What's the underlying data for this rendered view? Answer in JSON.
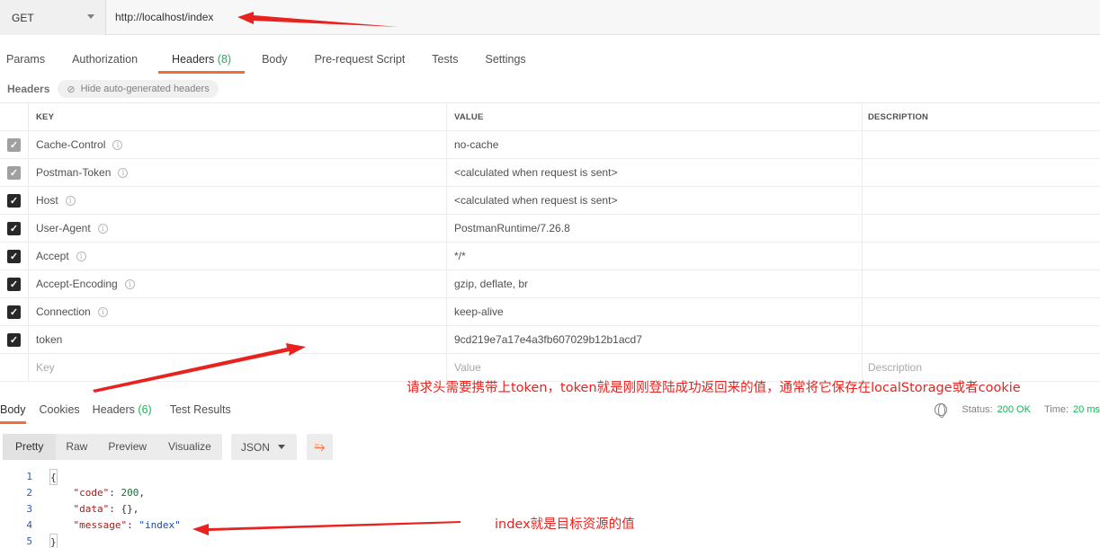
{
  "request": {
    "method": "GET",
    "url": "http://localhost/index"
  },
  "req_tabs": [
    {
      "label": "Params",
      "count": ""
    },
    {
      "label": "Authorization",
      "count": ""
    },
    {
      "label": "Headers",
      "count": "(8)"
    },
    {
      "label": "Body",
      "count": ""
    },
    {
      "label": "Pre-request Script",
      "count": ""
    },
    {
      "label": "Tests",
      "count": ""
    },
    {
      "label": "Settings",
      "count": ""
    }
  ],
  "headers_section": {
    "title": "Headers",
    "hide_label": "Hide auto-generated headers"
  },
  "table": {
    "columns": [
      "KEY",
      "VALUE",
      "DESCRIPTION"
    ],
    "rows": [
      {
        "key": "Cache-Control",
        "value": "no-cache",
        "checked": "grey",
        "info": "i"
      },
      {
        "key": "Postman-Token",
        "value": "<calculated when request is sent>",
        "checked": "grey",
        "info": "i"
      },
      {
        "key": "Host",
        "value": "<calculated when request is sent>",
        "checked": "dark",
        "info": "i"
      },
      {
        "key": "User-Agent",
        "value": "PostmanRuntime/7.26.8",
        "checked": "dark",
        "info": "i"
      },
      {
        "key": "Accept",
        "value": "*/*",
        "checked": "dark",
        "info": "i"
      },
      {
        "key": "Accept-Encoding",
        "value": "gzip, deflate, br",
        "checked": "dark",
        "info": "i"
      },
      {
        "key": "Connection",
        "value": "keep-alive",
        "checked": "dark",
        "info": "i"
      },
      {
        "key": "token",
        "value": "9cd219e7a17e4a3fb607029b12b1acd7",
        "checked": "dark",
        "info": ""
      }
    ],
    "placeholder": {
      "key": "Key",
      "value": "Value",
      "description": "Description"
    }
  },
  "response": {
    "tabs": [
      {
        "label": "Body",
        "count": ""
      },
      {
        "label": "Cookies",
        "count": ""
      },
      {
        "label": "Headers",
        "count": "(6)"
      },
      {
        "label": "Test Results",
        "count": ""
      }
    ],
    "status_label": "Status:",
    "status_value": "200 OK",
    "time_label": "Time:",
    "time_value": "20 ms",
    "view_modes": [
      "Pretty",
      "Raw",
      "Preview",
      "Visualize"
    ],
    "format": "JSON",
    "code_lines": [
      {
        "n": "1",
        "text": "{"
      },
      {
        "n": "2",
        "key": "\"code\"",
        "sep": ": ",
        "num": "200",
        "tail": ","
      },
      {
        "n": "3",
        "key": "\"data\"",
        "sep": ": ",
        "plain": "{}",
        "tail": ","
      },
      {
        "n": "4",
        "key": "\"message\"",
        "sep": ": ",
        "str": "\"index\"",
        "tail": ""
      },
      {
        "n": "5",
        "text": "}"
      }
    ]
  },
  "annotations": {
    "token_note": "请求头需要携带上token，token就是刚刚登陆成功返回来的值，通常将它保存在localStorage或者cookie",
    "index_note": "index就是目标资源的值"
  },
  "colors": {
    "accent": "#f26b3a",
    "success": "#0cbb52",
    "annotation": "#e8231f"
  }
}
